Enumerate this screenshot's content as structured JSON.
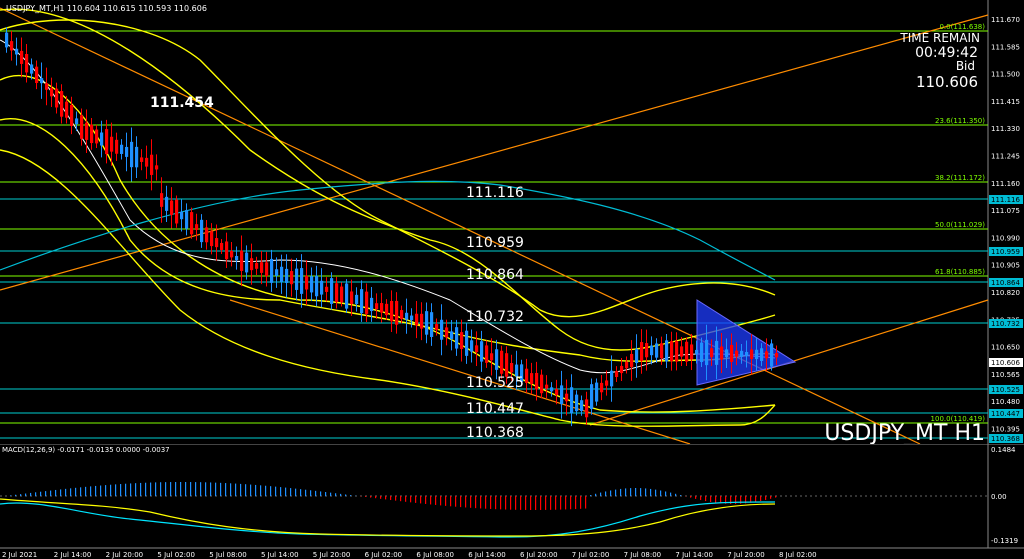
{
  "symbol_header": "USDJPY_MT,H1  110.604 110.615 110.593 110.606",
  "big_label": "111.454",
  "time_remain": {
    "title": "TIME REMAIN",
    "value": "00:49:42",
    "bid_label": "Bid",
    "bid_value": "110.606"
  },
  "watermark": "USDJPY_MT H1",
  "price_axis_ticks": [
    "111.670",
    "111.585",
    "111.500",
    "111.415",
    "111.330",
    "111.245",
    "111.160",
    "111.075",
    "110.990",
    "110.905",
    "110.820",
    "110.735",
    "110.650",
    "110.565",
    "110.480",
    "110.395"
  ],
  "level_labels": [
    {
      "text": "111.116",
      "color": "#00e5ff"
    },
    {
      "text": "110.959",
      "color": "#00e5ff"
    },
    {
      "text": "110.864",
      "color": "#00e5ff"
    },
    {
      "text": "110.732",
      "color": "#00e5ff"
    },
    {
      "text": "110.525",
      "color": "#00e5ff"
    },
    {
      "text": "110.447",
      "color": "#00e5ff"
    },
    {
      "text": "110.368",
      "color": "#00e5ff"
    }
  ],
  "level_tags": [
    "111.116",
    "110.959",
    "110.864",
    "110.732",
    "110.606",
    "110.525",
    "110.447",
    "110.368"
  ],
  "fib_labels": [
    "0.0(111.638)",
    "23.6(111.350)",
    "38.2(111.172)",
    "50.0(111.029)",
    "61.8(110.885)",
    "100.0(110.419)"
  ],
  "macd_header": "MACD(12,26,9) -0.0171 -0.0135 0.0000 -0.0037",
  "macd_axis_ticks": [
    "0.1484",
    "0.00",
    "-0.1319"
  ],
  "time_axis": [
    "2 Jul 2021",
    "2 Jul 14:00",
    "2 Jul 20:00",
    "5 Jul 02:00",
    "5 Jul 08:00",
    "5 Jul 14:00",
    "5 Jul 20:00",
    "6 Jul 02:00",
    "6 Jul 08:00",
    "6 Jul 14:00",
    "6 Jul 20:00",
    "7 Jul 02:00",
    "7 Jul 08:00",
    "7 Jul 14:00",
    "7 Jul 20:00",
    "8 Jul 02:00"
  ],
  "colors": {
    "bull": "#1e90ff",
    "bear": "#ff0000",
    "level": "#00e5ff",
    "fib": "#7fff00",
    "trend": "#ff8c00",
    "band": "#ffff00"
  }
}
